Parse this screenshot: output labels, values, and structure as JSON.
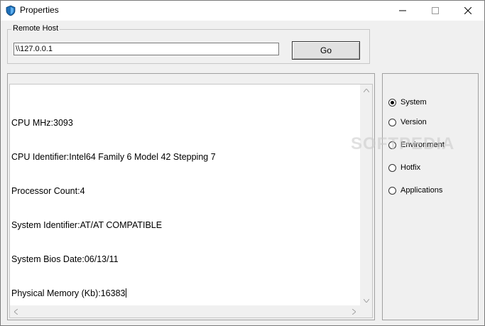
{
  "window": {
    "title": "Properties",
    "controls": {
      "minimize": "—",
      "maximize": "☐",
      "close": "✕"
    }
  },
  "remote_host": {
    "legend": "Remote Host",
    "value": "\\\\127.0.0.1",
    "go_label": "Go"
  },
  "output": {
    "lines": [
      "CPU MHz:3093",
      "CPU Identifier:Intel64 Family 6 Model 42 Stepping 7",
      "Processor Count:4",
      "System Identifier:AT/AT COMPATIBLE",
      "System Bios Date:06/13/11",
      "Physical Memory (Kb):16383"
    ]
  },
  "options": {
    "selected": "System",
    "items": [
      {
        "label": "System",
        "checked": true
      },
      {
        "label": "Version",
        "checked": false
      },
      {
        "label": "Environment",
        "checked": false
      },
      {
        "label": "Hotfix",
        "checked": false
      },
      {
        "label": "Applications",
        "checked": false
      }
    ]
  },
  "watermark": "SOFTPEDIA",
  "colors": {
    "icon_blue": "#1e6fb8",
    "icon_dark": "#0b3d6b"
  }
}
